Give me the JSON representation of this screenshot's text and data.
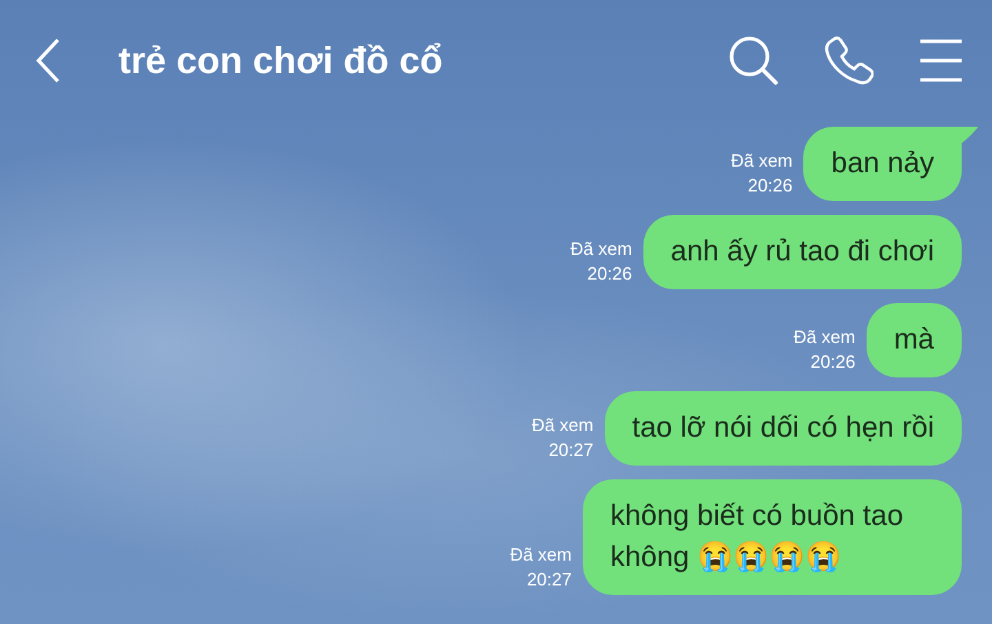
{
  "header": {
    "title": "trẻ con chơi đồ cổ"
  },
  "messages": [
    {
      "text": "ban nảy",
      "status": "Đã xem",
      "time": "20:26",
      "tail": true
    },
    {
      "text": "anh ấy rủ tao đi chơi",
      "status": "Đã xem",
      "time": "20:26",
      "tail": false
    },
    {
      "text": "mà",
      "status": "Đã xem",
      "time": "20:26",
      "tail": false
    },
    {
      "text": "tao lỡ nói dối có hẹn rồi",
      "status": "Đã xem",
      "time": "20:27",
      "tail": false
    },
    {
      "text": "không biết có buồn tao không 😭😭😭😭",
      "status": "Đã xem",
      "time": "20:27",
      "tail": false
    }
  ]
}
